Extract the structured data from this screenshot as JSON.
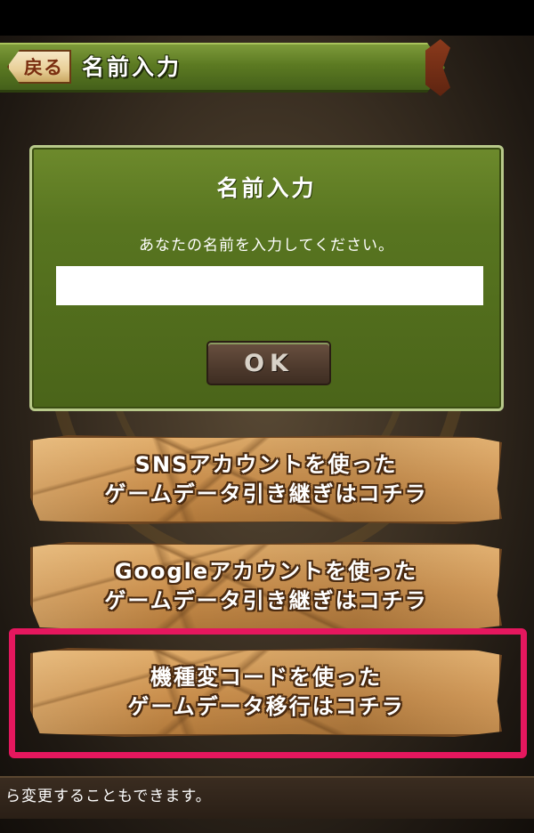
{
  "header": {
    "back_label": "戻る",
    "title": "名前入力"
  },
  "dialog": {
    "title": "名前入力",
    "message": "あなたの名前を入力してください。",
    "input_value": "",
    "ok_label": "OK"
  },
  "transfer_buttons": [
    {
      "line1": "SNSアカウントを使った",
      "line2": "ゲームデータ引き継ぎはコチラ"
    },
    {
      "line1": "Googleアカウントを使った",
      "line2": "ゲームデータ引き継ぎはコチラ"
    },
    {
      "line1": "機種変コードを使った",
      "line2": "ゲームデータ移行はコチラ"
    }
  ],
  "footer": {
    "text": "ら変更することもできます。"
  },
  "colors": {
    "header_green": "#5c7a22",
    "dialog_green": "#587520",
    "stone": "#c98e4c",
    "highlight": "#e5175e",
    "back_text": "#7a2e10"
  }
}
